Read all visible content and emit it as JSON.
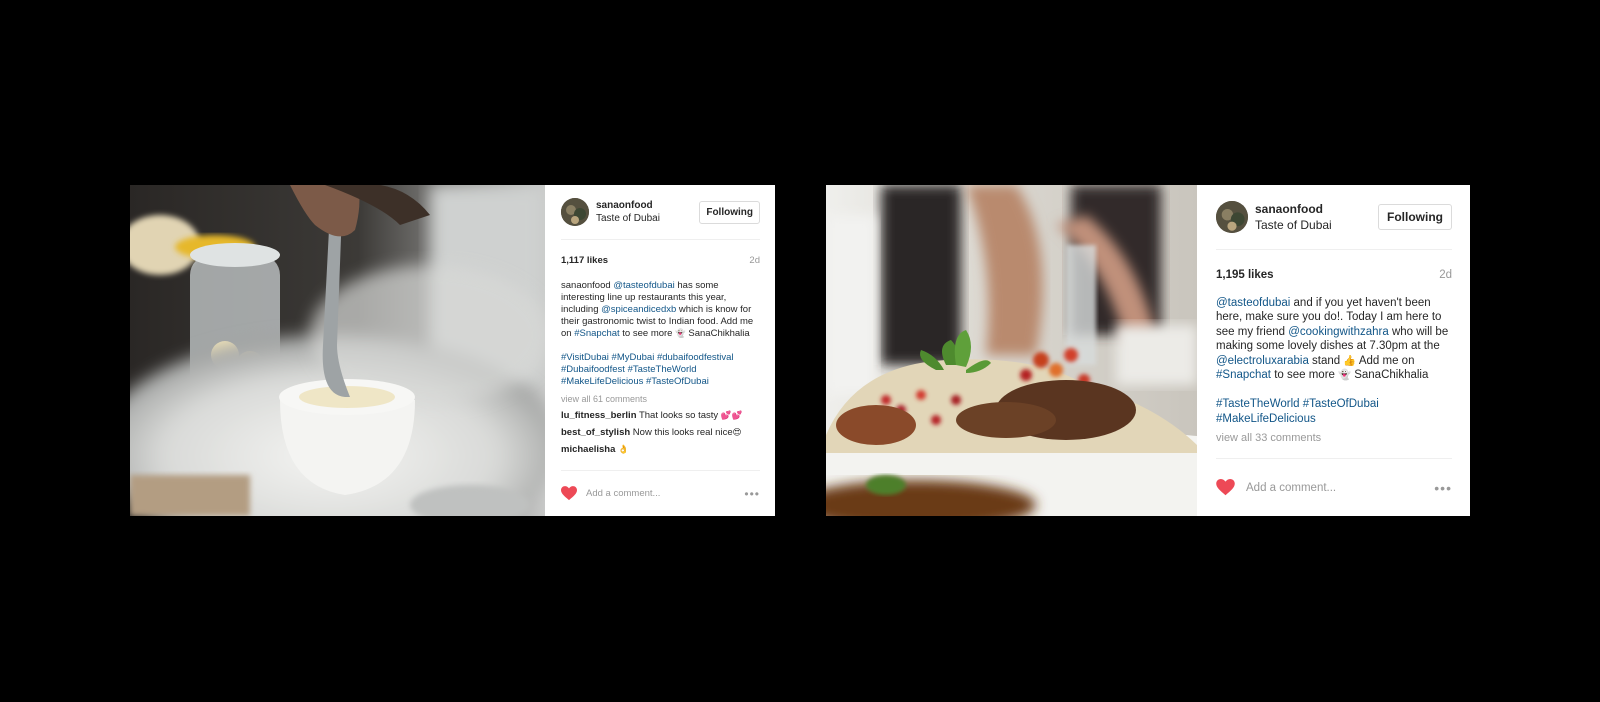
{
  "colors": {
    "background": "#000000",
    "link": "#125688",
    "heart": "#ed4956",
    "muted": "#999999"
  },
  "posts": [
    {
      "username": "sanaonfood",
      "location": "Taste of Dubai",
      "follow_label": "Following",
      "likes": "1,117 likes",
      "age": "2d",
      "caption": {
        "user": "sanaonfood",
        "mention1": "@tasteofdubai",
        "text1": " has some interesting line up restaurants this year, including ",
        "mention2": "@spiceandicedxb",
        "text2": " which is know for their gastronomic twist to Indian food. Add me on ",
        "hashtag": "#Snapchat",
        "text3": " to see more ",
        "emoji": "👻",
        "text4": " SanaChikhalia"
      },
      "hashtags": [
        "#VisitDubai",
        "#MyDubai",
        "#dubaifoodfestival",
        "#Dubaifoodfest",
        "#TasteTheWorld",
        "#MakeLifeDelicious",
        "#TasteOfDubai"
      ],
      "view_all": "view all 61 comments",
      "comments": [
        {
          "user": "lu_fitness_berlin",
          "text": " That looks so tasty ",
          "emoji": "💕💕"
        },
        {
          "user": "best_of_stylish",
          "text": " Now this looks real nice",
          "emoji": "😍"
        },
        {
          "user": "michaelisha",
          "text": " ",
          "emoji": "👌"
        }
      ],
      "add_comment_placeholder": "Add a comment...",
      "more_icon": "ellipsis-icon",
      "heart_icon": "heart-icon"
    },
    {
      "username": "sanaonfood",
      "location": "Taste of Dubai",
      "follow_label": "Following",
      "likes": "1,195 likes",
      "age": "2d",
      "caption": {
        "mention1": "@tasteofdubai",
        "text1": " and if you yet haven't been here, make sure you do!. Today I am here to see my friend ",
        "mention2": "@cookingwithzahra",
        "text2": " who will be making some lovely dishes at 7.30pm at the ",
        "mention3": "@electroluxarabia",
        "text3": " stand ",
        "emoji1": "👍",
        "text4": " Add me on ",
        "hashtag": "#Snapchat",
        "text5": " to see more ",
        "emoji2": "👻",
        "text6": " SanaChikhalia"
      },
      "hashtags": [
        "#TasteTheWorld",
        "#TasteOfDubai",
        "#MakeLifeDelicious"
      ],
      "view_all": "view all 33 comments",
      "add_comment_placeholder": "Add a comment...",
      "more_icon": "ellipsis-icon",
      "heart_icon": "heart-icon"
    }
  ]
}
